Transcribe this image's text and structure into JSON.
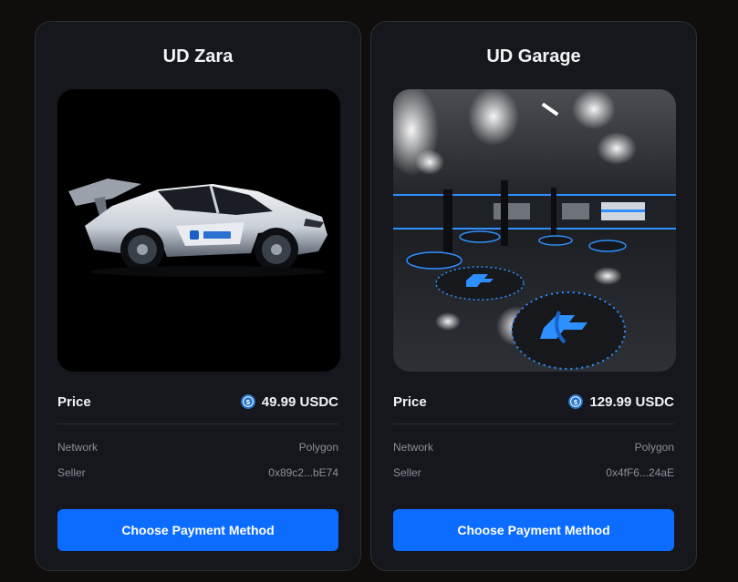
{
  "cards": [
    {
      "title": "UD Zara",
      "price_label": "Price",
      "price": "49.99 USDC",
      "network_label": "Network",
      "network": "Polygon",
      "seller_label": "Seller",
      "seller": "0x89c2...bE74",
      "button_label": "Choose Payment Method",
      "image": "sports-car-render"
    },
    {
      "title": "UD Garage",
      "price_label": "Price",
      "price": "129.99 USDC",
      "network_label": "Network",
      "network": "Polygon",
      "seller_label": "Seller",
      "seller": "0x4fF6...24aE",
      "button_label": "Choose Payment Method",
      "image": "garage-render"
    }
  ],
  "colors": {
    "background": "#0f0e0c",
    "card": "#15171c",
    "accent": "#0b6cff",
    "usdc": "#2775ca"
  },
  "icons": {
    "currency": "usdc-coin-icon"
  }
}
